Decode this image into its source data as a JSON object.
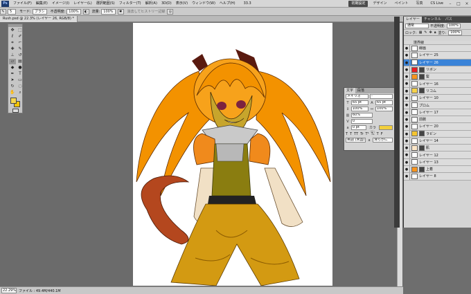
{
  "menubar": {
    "logo": "Ps",
    "items": [
      "ファイル(F)",
      "編集(E)",
      "イメージ(I)",
      "レイヤー(L)",
      "選択範囲(S)",
      "フィルター(T)",
      "解析(A)",
      "3D(D)",
      "表示(V)",
      "ウィンドウ(W)",
      "ヘルプ(H)"
    ],
    "zoom": "33.3",
    "workspaces": [
      "初期設定",
      "デザイン",
      "ペイント",
      "写真"
    ],
    "active_workspace": "初期設定",
    "cs_live": "CS Live"
  },
  "options": {
    "mode_label": "モード:",
    "mode_value": "ブラシ",
    "opacity_label": "不透明度:",
    "opacity_value": "100%",
    "flow_label": "流量:",
    "flow_value": "100%",
    "history_label": "消去してヒストリー記録",
    "brush_size": "5"
  },
  "document": {
    "tab": "Rush.psd @ 22.3% (レイヤー 26, RGB/8) *",
    "status_zoom": "22.29%",
    "status_info": "ファイル : 49.4M/440.1M"
  },
  "character_panel": {
    "tabs": [
      "文字",
      "段落"
    ],
    "font": "メイリオ",
    "style": "-",
    "size": "65 pt",
    "leading": "65 pt",
    "vscale": "100%",
    "hscale": "100%",
    "tsume": "60%",
    "tracking": "0",
    "baseline": "0 pt",
    "color_label": "カラー:",
    "color": "#f2cf3c",
    "language": "英語 (米国)",
    "antialias": "滑らかに"
  },
  "layers_panel": {
    "tabs": [
      "レイヤー",
      "チャンネル",
      "パス"
    ],
    "blend_mode": "通常",
    "opacity_label": "不透明度:",
    "opacity": "100%",
    "lock_label": "ロック:",
    "fill_label": "塗り:",
    "fill": "100%",
    "layers": [
      {
        "name": "境界線",
        "sub": true
      },
      {
        "name": "線画"
      },
      {
        "name": "レイヤー 25"
      },
      {
        "name": "レイヤー 26",
        "selected": true
      },
      {
        "name": "リボン",
        "thumb": "#e81c24"
      },
      {
        "name": "髪",
        "thumb": "#f7941d"
      },
      {
        "name": "レイヤー 16"
      },
      {
        "name": "リコム",
        "thumb": "#f6d24a"
      },
      {
        "name": "レイヤー 10"
      },
      {
        "name": "プロム"
      },
      {
        "name": "レイヤー 17"
      },
      {
        "name": "前腕"
      },
      {
        "name": "レイヤー 20"
      },
      {
        "name": "ラビン",
        "thumb": "#f4c430"
      },
      {
        "name": "レイヤー 14"
      },
      {
        "name": "肌",
        "thumb": "#fbe6c8"
      },
      {
        "name": "レイヤー 12"
      },
      {
        "name": "レイヤー 13"
      },
      {
        "name": "上着",
        "thumb": "#f7941d"
      },
      {
        "name": "レイヤー 8"
      }
    ]
  }
}
